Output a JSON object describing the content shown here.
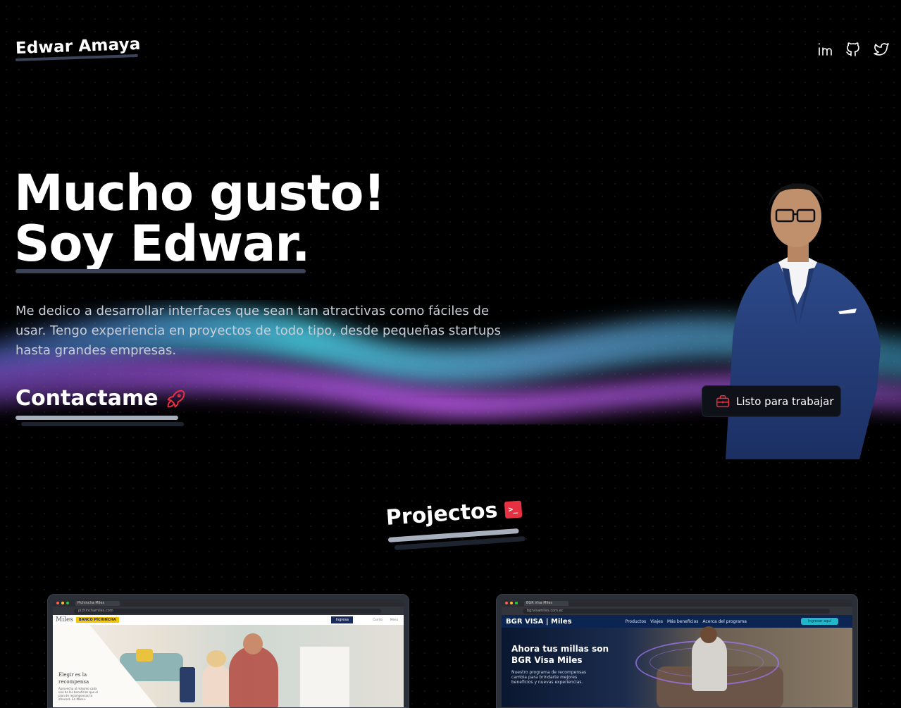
{
  "header": {
    "brand": "Edwar Amaya",
    "social": [
      {
        "name": "linkedin-icon"
      },
      {
        "name": "github-icon"
      },
      {
        "name": "twitter-icon"
      }
    ]
  },
  "hero": {
    "title_line1": "Mucho gusto!",
    "title_line2": "Soy Edwar.",
    "description": "Me dedico a desarrollar interfaces que sean tan atractivas como fáciles de usar. Tengo experiencia en proyectos de todo tipo, desde pequeñas startups hasta grandes empresas.",
    "contact_label": "Contactame",
    "badge_label": "Listo para trabajar"
  },
  "projects": {
    "title": "Projectos",
    "items": [
      {
        "tab": "Pichincha Miles",
        "url": "pichinchamiles.com",
        "logo": "Miles",
        "bank": "BANCO PICHINCHA",
        "cta": "Ingresa",
        "nav_links": [
          "Carrito",
          "Menú"
        ],
        "headline": "Elegir es la recompensa",
        "body": "Aprovecha al máximo cada uno de los beneficios que el plan de recompensas te ofrecerá. En Miles+"
      },
      {
        "tab": "BGR Visa Miles",
        "url": "bgrvisamiles.com.ec",
        "logo": "BGR VISA | Miles",
        "nav_links": [
          "Productos",
          "Viajes",
          "Más beneficios",
          "Acerca del programa"
        ],
        "cta": "Ingresar aquí",
        "headline": "Ahora tus millas son BGR Visa Miles",
        "body": "Nuestro programa de recompensas cambia para brindarte mejores beneficios y nuevas experiencias."
      }
    ]
  },
  "colors": {
    "background": "#000000",
    "accent_red": "#e53142",
    "underline": "#3a4458",
    "wave_cyan": "#3fd6e0",
    "wave_purple": "#b85cf0"
  }
}
